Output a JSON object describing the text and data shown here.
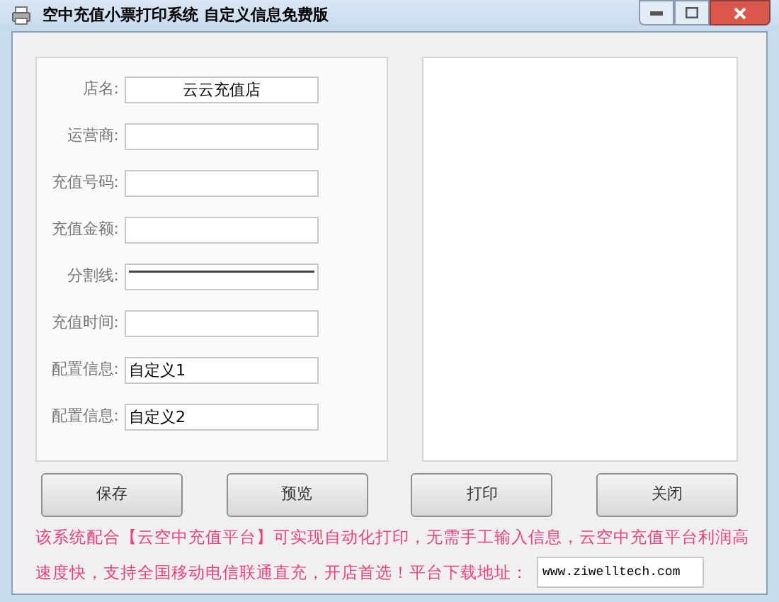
{
  "window": {
    "title": "空中充值小票打印系统 自定义信息免费版"
  },
  "form": [
    {
      "label": "店名:",
      "kind": "text",
      "value": "云云充值店",
      "centered": true
    },
    {
      "label": "运营商:",
      "kind": "text"
    },
    {
      "label": "充值号码:",
      "kind": "text"
    },
    {
      "label": "充值金额:",
      "kind": "text"
    },
    {
      "label": "分割线:",
      "kind": "line"
    },
    {
      "label": "充值时间:",
      "kind": "text"
    },
    {
      "label": "配置信息:",
      "kind": "text",
      "value": "自定义1",
      "centered": false
    },
    {
      "label": "配置信息:",
      "kind": "text",
      "value": "自定义2",
      "centered": false
    }
  ],
  "buttons": [
    "保存",
    "预览",
    "打印",
    "关闭"
  ],
  "notice": {
    "line_1": "该系统配合【云空中充值平台】可实现自动化打印，无需手工输入信息，云空中充值平台利润高",
    "line_2": "速度快，支持全国移动电信联通直充，开店首选！平台下载地址：",
    "url": "www.ziwelltech.com"
  }
}
